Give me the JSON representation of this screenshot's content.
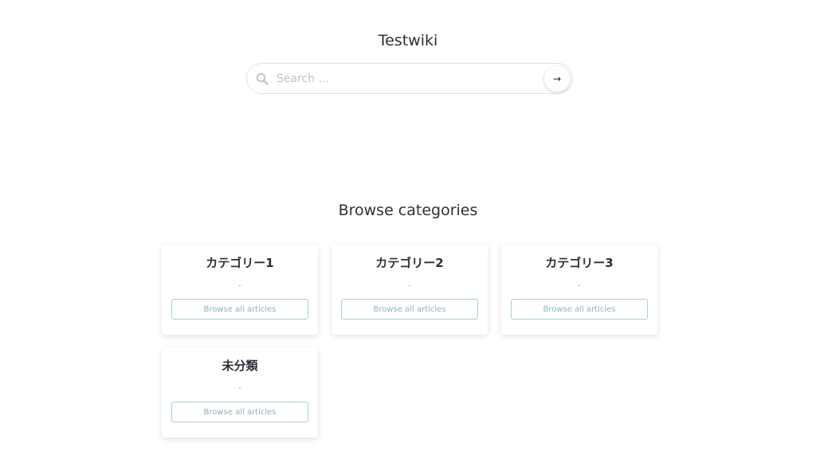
{
  "header": {
    "title": "Testwiki"
  },
  "search": {
    "placeholder": "Search ...",
    "search_icon": "search-icon",
    "submit_icon": "arrow-right-icon",
    "submit_glyph": "→"
  },
  "section": {
    "title": "Browse categories"
  },
  "categories": [
    {
      "name": "カテゴリー1",
      "description": ".",
      "button": "Browse all articles"
    },
    {
      "name": "カテゴリー2",
      "description": ".",
      "button": "Browse all articles"
    },
    {
      "name": "カテゴリー3",
      "description": ".",
      "button": "Browse all articles"
    },
    {
      "name": "未分類",
      "description": ".",
      "button": "Browse all articles"
    }
  ],
  "colors": {
    "button_border": "#a9cfd1",
    "button_text": "#8fb4b8",
    "text": "#2d3038"
  }
}
